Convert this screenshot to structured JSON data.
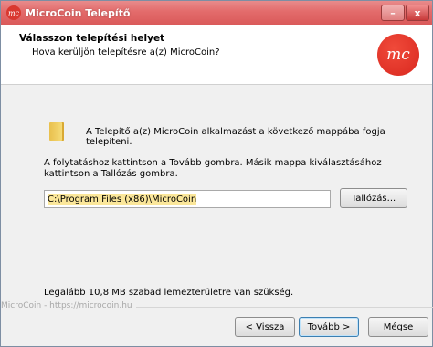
{
  "window": {
    "title": "MicroCoin Telepítő",
    "icon": "microcoin-icon",
    "minimize_glyph": "–",
    "close_glyph": "x"
  },
  "header": {
    "title": "Válasszon telepítési helyet",
    "subtitle": "Hova kerüljön telepítésre a(z) MicroCoin?",
    "logo_text": "mc"
  },
  "content": {
    "info": "A Telepítő a(z) MicroCoin alkalmazást a következő mappába fogja telepíteni.",
    "instruction": "A folytatáshoz kattintson a Tovább gombra. Másik mappa kiválasztásához kattintson a Tallózás gombra.",
    "path_value": "C:\\Program Files (x86)\\MicroCoin",
    "browse_label": "Tallózás...",
    "space_required": "Legalább 10,8 MB szabad lemezterületre van szükség."
  },
  "footer": {
    "brand": "MicroCoin - https://microcoin.hu",
    "back_label": "< Vissza",
    "next_label": "Tovább >",
    "cancel_label": "Mégse"
  },
  "colors": {
    "titlebar": "#e36b6b",
    "logo": "#d9281f",
    "selection": "#fbe79a"
  }
}
